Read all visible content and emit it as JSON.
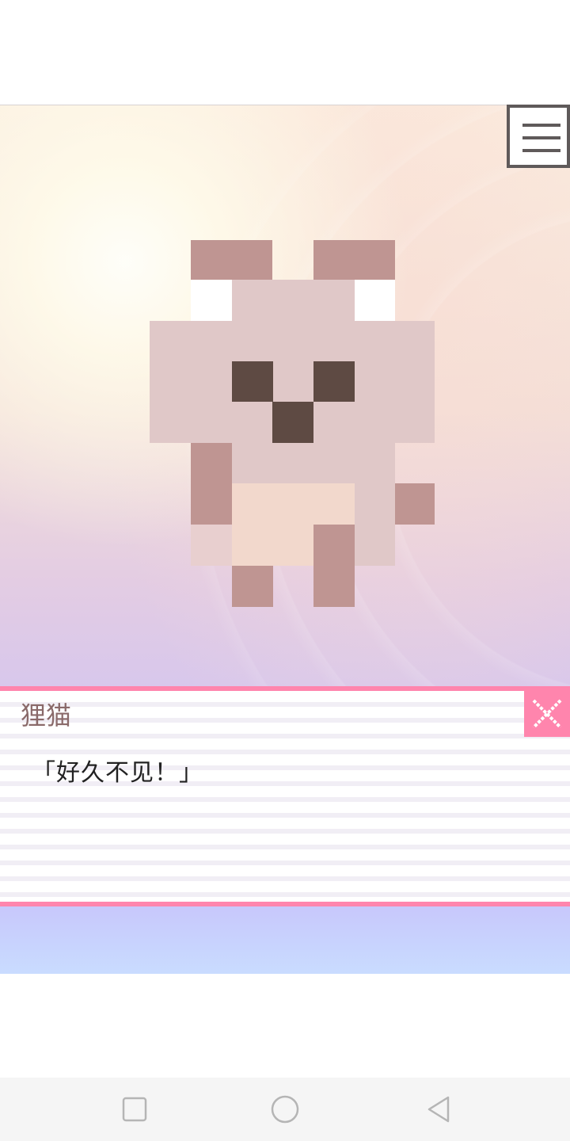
{
  "dialog": {
    "speaker": "狸猫",
    "text": "「好久不见！」"
  },
  "menu": {
    "icon": "hamburger-menu-icon"
  },
  "close": {
    "icon": "close-x-icon"
  },
  "navigation": {
    "buttons": [
      "recent-apps-square-icon",
      "home-circle-icon",
      "back-triangle-icon"
    ]
  },
  "colors": {
    "accent_pink": "#ff85ad",
    "sprite_ear": "#bf9592",
    "sprite_body": "#e0c8c8",
    "sprite_belly": "#f2d8cc",
    "sprite_eye": "#5e4a43",
    "sprite_white": "#ffffff",
    "sprite_shadow": "#e8cfcf"
  }
}
